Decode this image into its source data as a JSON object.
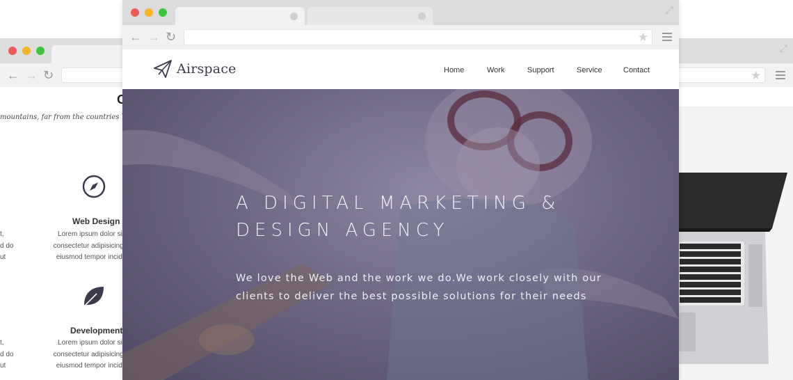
{
  "front": {
    "logo_text": "Airspace",
    "nav": [
      "Home",
      "Work",
      "Support",
      "Service",
      "Contact"
    ],
    "hero": {
      "heading_line1": "A DIGITAL MARKETING &",
      "heading_line2": "DESIGN AGENCY",
      "paragraph_line1": "We love the Web and the work we do.We work closely with our",
      "paragraph_line2": "clients to deliver the best possible solutions for their needs"
    }
  },
  "back_left": {
    "heading_fragment": "O",
    "subtitle_fragment": "mountains, far from the countries Vokal",
    "services": [
      {
        "title": "Web Design",
        "icon": "compass-icon",
        "desc": [
          "Lorem ipsum dolor sit a",
          "consectetur adipisicing elit",
          "eiusmod tempor incididu"
        ],
        "left_frag": [
          "t,",
          "d do",
          "ut"
        ]
      },
      {
        "title": "Development",
        "icon": "leaf-icon",
        "desc": [
          "Lorem ipsum dolor sit a",
          "consectetur adipisicing elit",
          "eiusmod tempor incididu"
        ],
        "left_frag": [
          "t,",
          "d do",
          "ut"
        ]
      }
    ]
  },
  "colors": {
    "hero_overlay": "#6e6783",
    "logo": "#3d3a4e",
    "chrome": "#dedede"
  }
}
